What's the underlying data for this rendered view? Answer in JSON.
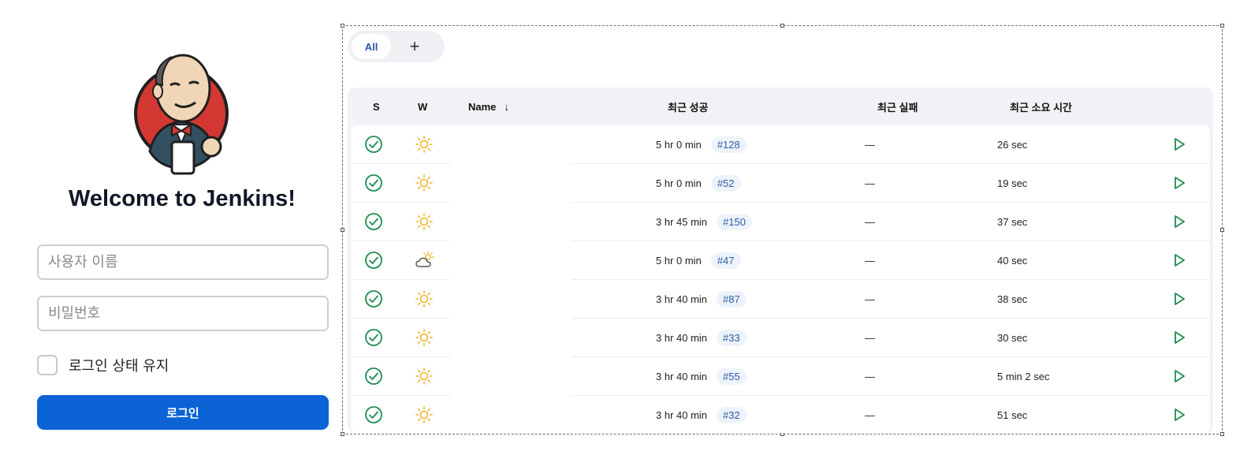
{
  "login": {
    "welcome": "Welcome to Jenkins!",
    "username_placeholder": "사용자 이름",
    "password_placeholder": "비밀번호",
    "remember_label": "로그인 상태 유지",
    "submit_label": "로그인"
  },
  "dashboard": {
    "tabs": [
      {
        "label": "All"
      },
      {
        "label": "+"
      }
    ],
    "columns": {
      "status": "S",
      "weather": "W",
      "name": "Name",
      "name_sort": "↓",
      "last_success": "최근 성공",
      "last_failure": "최근 실패",
      "last_duration": "최근 소요 시간"
    },
    "jobs": [
      {
        "weather": "sun-icon",
        "last_success": "5 hr 0 min",
        "build": "#128",
        "last_failure": "—",
        "duration": "26 sec"
      },
      {
        "weather": "sun-icon",
        "last_success": "5 hr 0 min",
        "build": "#52",
        "last_failure": "—",
        "duration": "19 sec"
      },
      {
        "weather": "sun-icon",
        "last_success": "3 hr 45 min",
        "build": "#150",
        "last_failure": "—",
        "duration": "37 sec"
      },
      {
        "weather": "partly-cloudy-icon",
        "last_success": "5 hr 0 min",
        "build": "#47",
        "last_failure": "—",
        "duration": "40 sec"
      },
      {
        "weather": "sun-icon",
        "last_success": "3 hr 40 min",
        "build": "#87",
        "last_failure": "—",
        "duration": "38 sec"
      },
      {
        "weather": "sun-icon",
        "last_success": "3 hr 40 min",
        "build": "#33",
        "last_failure": "—",
        "duration": "30 sec"
      },
      {
        "weather": "sun-icon",
        "last_success": "3 hr 40 min",
        "build": "#55",
        "last_failure": "—",
        "duration": "5 min 2 sec"
      },
      {
        "weather": "sun-icon",
        "last_success": "3 hr 40 min",
        "build": "#32",
        "last_failure": "—",
        "duration": "51 sec"
      }
    ]
  },
  "colors": {
    "accent": "#0b63d6",
    "success": "#1e8e4e",
    "sun": "#f0b429",
    "link": "#2a5ea8"
  }
}
